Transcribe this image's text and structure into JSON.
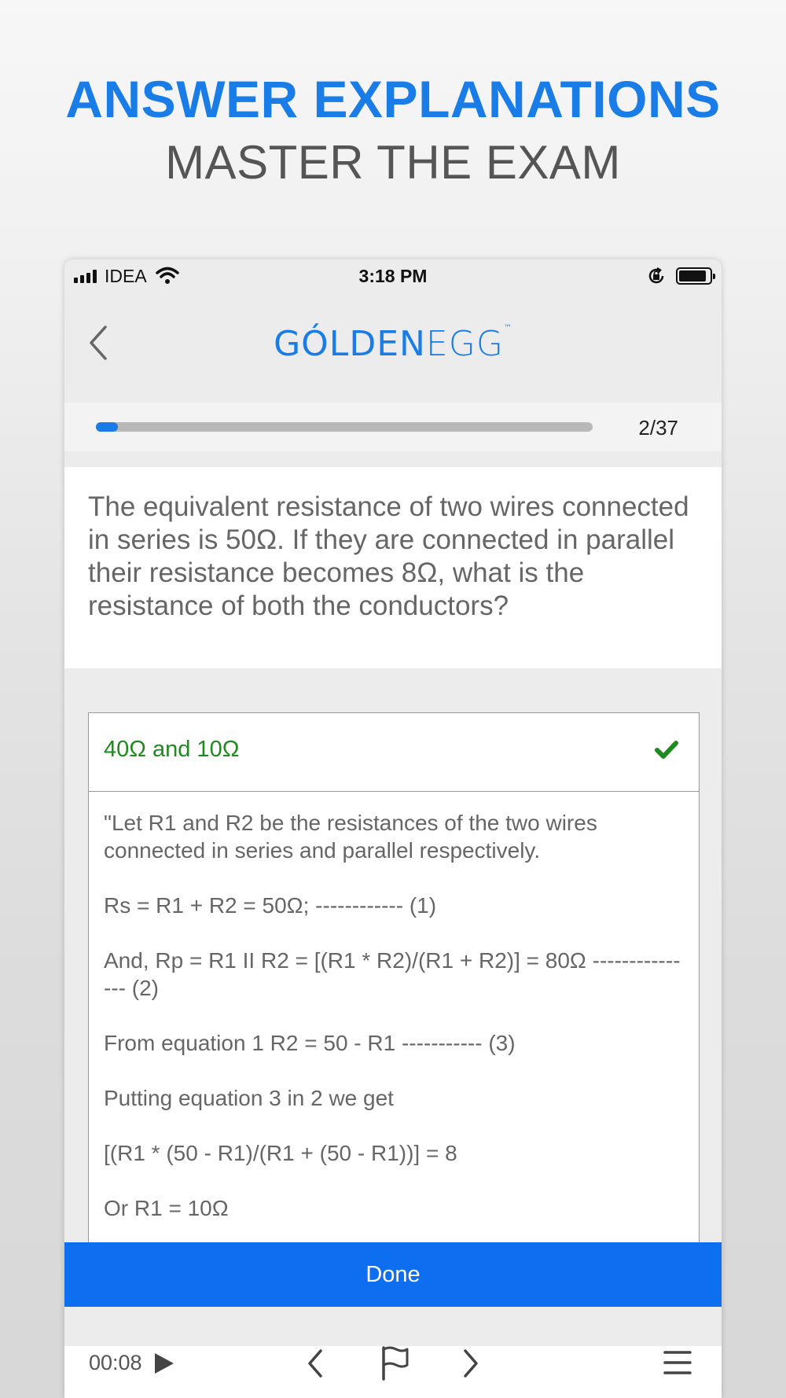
{
  "promo": {
    "title": "ANSWER EXPLANATIONS",
    "subtitle": "MASTER THE EXAM"
  },
  "status_bar": {
    "carrier": "IDEA",
    "time": "3:18 PM"
  },
  "header": {
    "logo_gold": "GÓLDEN",
    "logo_egg": "EGG",
    "logo_tm": "™",
    "brand_color": "#1a7ce6"
  },
  "progress": {
    "current": 2,
    "total": 37,
    "label": "2/37",
    "fraction": 0.045
  },
  "question": {
    "text": "The equivalent resistance of two wires connected in series is 50Ω. If they are connected in parallel their resistance becomes 8Ω, what is the resistance of both the conductors?"
  },
  "answer": {
    "text": "40Ω and 10Ω",
    "status": "correct",
    "status_color": "#1f8a1f"
  },
  "explanation": {
    "paragraphs": [
      "\"Let R1 and R2 be the resistances of the two wires connected in series and parallel respectively.",
      "Rs = R1 + R2 = 50Ω; ------------ (1)",
      "And, Rp = R1 II R2 = [(R1 * R2)/(R1 + R2)] = 80Ω --------------- (2)",
      "From equation 1 R2 = 50 - R1 ----------- (3)",
      "Putting equation 3 in 2 we get",
      "[(R1 * (50 - R1)/(R1 + (50 - R1))] = 8",
      "Or R1 = 10Ω"
    ]
  },
  "done_button": {
    "label": "Done",
    "color": "#0d6ef0"
  },
  "bottom_bar": {
    "timer": "00:08"
  }
}
